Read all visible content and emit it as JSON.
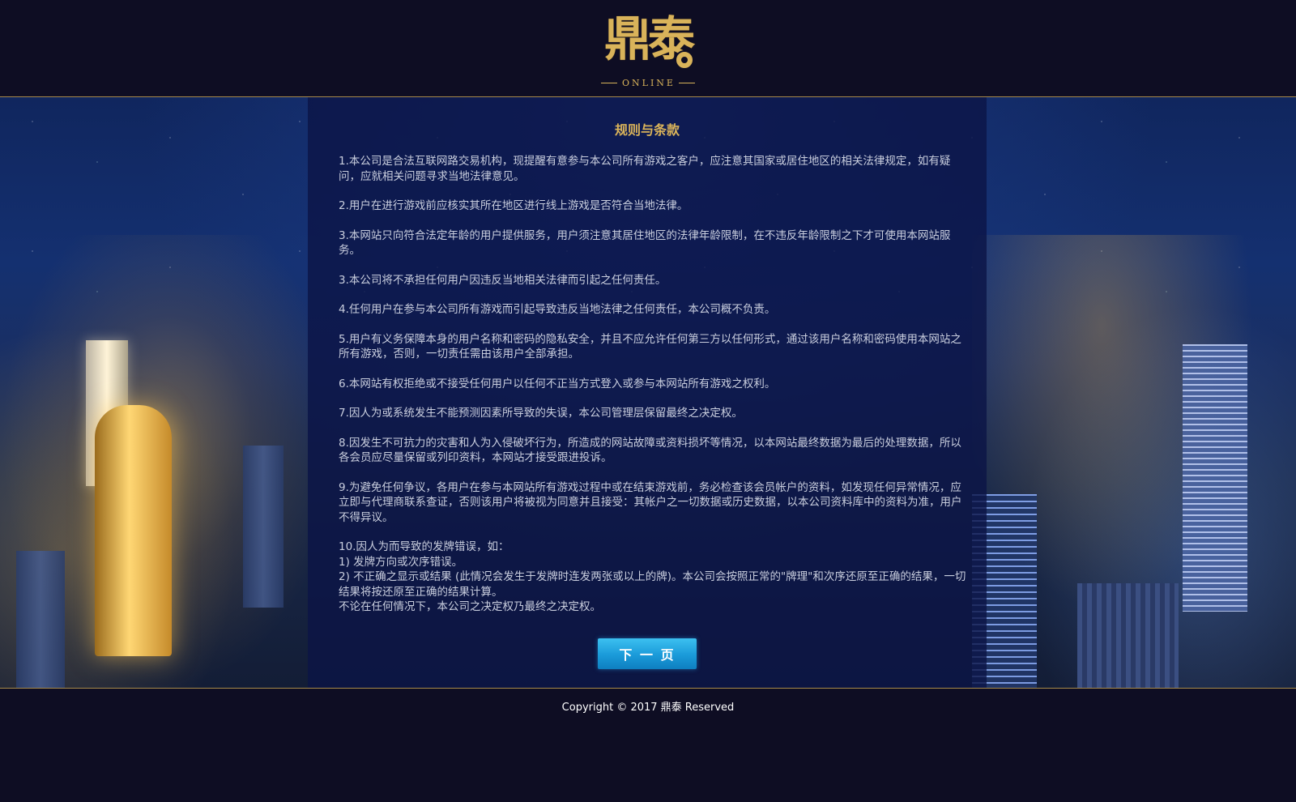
{
  "brand": {
    "logo_text": "鼎泰",
    "logo_subtitle": "ONLINE",
    "accent_color": "#d9b35a"
  },
  "terms": {
    "title": "规则与条款",
    "items": [
      "1.本公司是合法互联网路交易机构，现提醒有意参与本公司所有游戏之客户，应注意其国家或居住地区的相关法律规定，如有疑问，应就相关问题寻求当地法律意见。",
      "2.用户在进行游戏前应核实其所在地区进行线上游戏是否符合当地法律。",
      "3.本网站只向符合法定年龄的用户提供服务，用户须注意其居住地区的法律年龄限制，在不违反年龄限制之下才可使用本网站服务。",
      "3.本公司将不承担任何用户因违反当地相关法律而引起之任何责任。",
      "4.任何用户在参与本公司所有游戏而引起导致违反当地法律之任何责任，本公司概不负责。",
      "5.用户有义务保障本身的用户名称和密码的隐私安全，并且不应允许任何第三方以任何形式，通过该用户名称和密码使用本网站之所有游戏，否则，一切责任需由该用户全部承担。",
      "6.本网站有权拒绝或不接受任何用户以任何不正当方式登入或参与本网站所有游戏之权利。",
      "7.因人为或系统发生不能预测因素所导致的失误，本公司管理层保留最终之决定权。",
      "8.因发生不可抗力的灾害和人为入侵破坏行为，所造成的网站故障或资料损坏等情况，以本网站最终数据为最后的处理数据，所以各会员应尽量保留或列印资料，本网站才接受跟进投诉。",
      "9.为避免任何争议，各用户在参与本网站所有游戏过程中或在结束游戏前，务必检查该会员帐户的资料，如发现任何异常情况，应立即与代理商联系查证，否则该用户将被视为同意并且接受：其帐户之一切数据或历史数据，以本公司资料库中的资料为准，用户不得异议。"
    ],
    "item10": {
      "intro": "10.因人为而导致的发牌错误，如：",
      "point1": "1) 发牌方向或次序错误。",
      "point2": "2) 不正确之显示或结果 (此情况会发生于发牌时连发两张或以上的牌)。本公司会按照正常的\"牌理\"和次序还原至正确的结果，一切结果将按还原至正确的结果计算。",
      "closing": "不论在任何情况下，本公司之决定权乃最终之决定权。"
    },
    "next_label": "下 一 页"
  },
  "footer": {
    "copyright": "Copyright © 2017 鼎泰 Reserved"
  }
}
